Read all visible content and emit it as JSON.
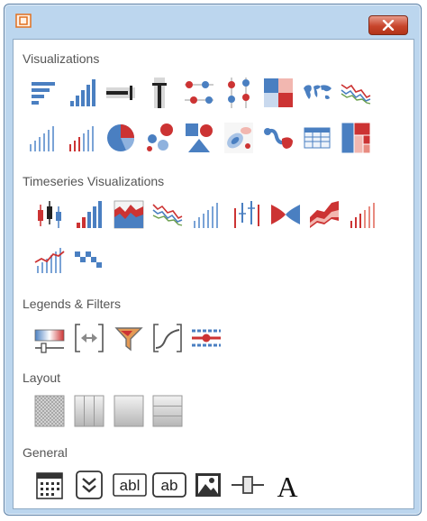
{
  "sections": {
    "visualizations": "Visualizations",
    "timeseries": "Timeseries Visualizations",
    "legends": "Legends & Filters",
    "layout": "Layout",
    "general": "General"
  },
  "general_tools": {
    "textbox_label": "abl",
    "label_label": "ab",
    "text_glyph": "A"
  },
  "colors": {
    "accent_blue": "#4a7fc1",
    "accent_red": "#cc3333",
    "window_frame": "#bcd6ee",
    "close_button": "#c8452c"
  }
}
